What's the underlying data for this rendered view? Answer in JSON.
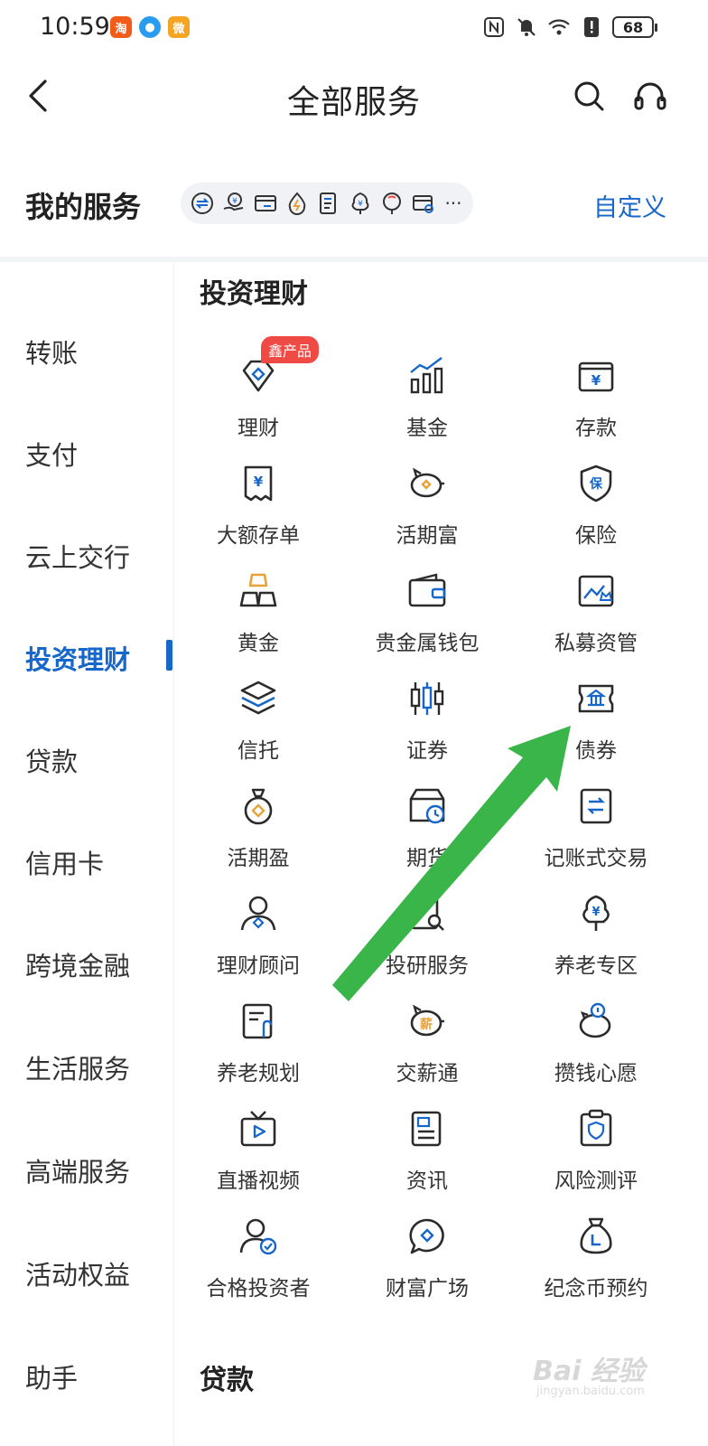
{
  "status_bar": {
    "time": "10:59",
    "battery": "68",
    "app_icons": [
      {
        "label": "淘",
        "color": "#f25c19"
      },
      {
        "label": "●",
        "color": "#2a9cf0"
      },
      {
        "label": "微",
        "color": "#f4a422"
      }
    ]
  },
  "header": {
    "title": "全部服务"
  },
  "my_services": {
    "title": "我的服务",
    "customize_label": "自定义",
    "more_label": "···"
  },
  "sidebar": {
    "items": [
      {
        "label": "转账"
      },
      {
        "label": "支付"
      },
      {
        "label": "云上交行"
      },
      {
        "label": "投资理财"
      },
      {
        "label": "贷款"
      },
      {
        "label": "信用卡"
      },
      {
        "label": "跨境金融"
      },
      {
        "label": "生活服务"
      },
      {
        "label": "高端服务"
      },
      {
        "label": "活动权益"
      },
      {
        "label": "助手"
      }
    ],
    "active_index": 3
  },
  "sections": {
    "invest": {
      "title": "投资理财",
      "items": [
        {
          "label": "理财",
          "icon": "wealth-diamond-icon",
          "badge": "鑫产品"
        },
        {
          "label": "基金",
          "icon": "fund-chart-icon"
        },
        {
          "label": "存款",
          "icon": "deposit-box-icon"
        },
        {
          "label": "大额存单",
          "icon": "certificate-icon"
        },
        {
          "label": "活期富",
          "icon": "piggy-bank-icon"
        },
        {
          "label": "保险",
          "icon": "insurance-shield-icon"
        },
        {
          "label": "黄金",
          "icon": "gold-bars-icon"
        },
        {
          "label": "贵金属钱包",
          "icon": "wallet-icon"
        },
        {
          "label": "私募资管",
          "icon": "private-fund-icon"
        },
        {
          "label": "信托",
          "icon": "layers-icon"
        },
        {
          "label": "证券",
          "icon": "candlestick-icon"
        },
        {
          "label": "债券",
          "icon": "bond-bank-icon"
        },
        {
          "label": "活期盈",
          "icon": "money-bag-icon"
        },
        {
          "label": "期货",
          "icon": "futures-clock-icon"
        },
        {
          "label": "记账式交易",
          "icon": "transfer-clipboard-icon"
        },
        {
          "label": "理财顾问",
          "icon": "advisor-icon"
        },
        {
          "label": "投研服务",
          "icon": "research-search-icon"
        },
        {
          "label": "养老专区",
          "icon": "pension-tree-icon"
        },
        {
          "label": "养老规划",
          "icon": "plan-document-icon"
        },
        {
          "label": "交薪通",
          "icon": "salary-piggy-icon"
        },
        {
          "label": "攒钱心愿",
          "icon": "savings-wish-icon"
        },
        {
          "label": "直播视频",
          "icon": "live-tv-icon"
        },
        {
          "label": "资讯",
          "icon": "news-icon"
        },
        {
          "label": "风险测评",
          "icon": "risk-assessment-icon"
        },
        {
          "label": "合格投资者",
          "icon": "qualified-investor-icon"
        },
        {
          "label": "财富广场",
          "icon": "wealth-chat-icon"
        },
        {
          "label": "纪念币预约",
          "icon": "coin-bag-icon"
        }
      ]
    },
    "loan": {
      "title": "贷款"
    }
  },
  "watermark": {
    "text": "Bai 经验",
    "sub": "jingyan.baidu.com"
  },
  "colors": {
    "accent": "#1766c9",
    "badge": "#f04a45",
    "icon_dark": "#2b2b2b",
    "icon_gold": "#e8a23a",
    "arrow": "#3ab54a"
  }
}
